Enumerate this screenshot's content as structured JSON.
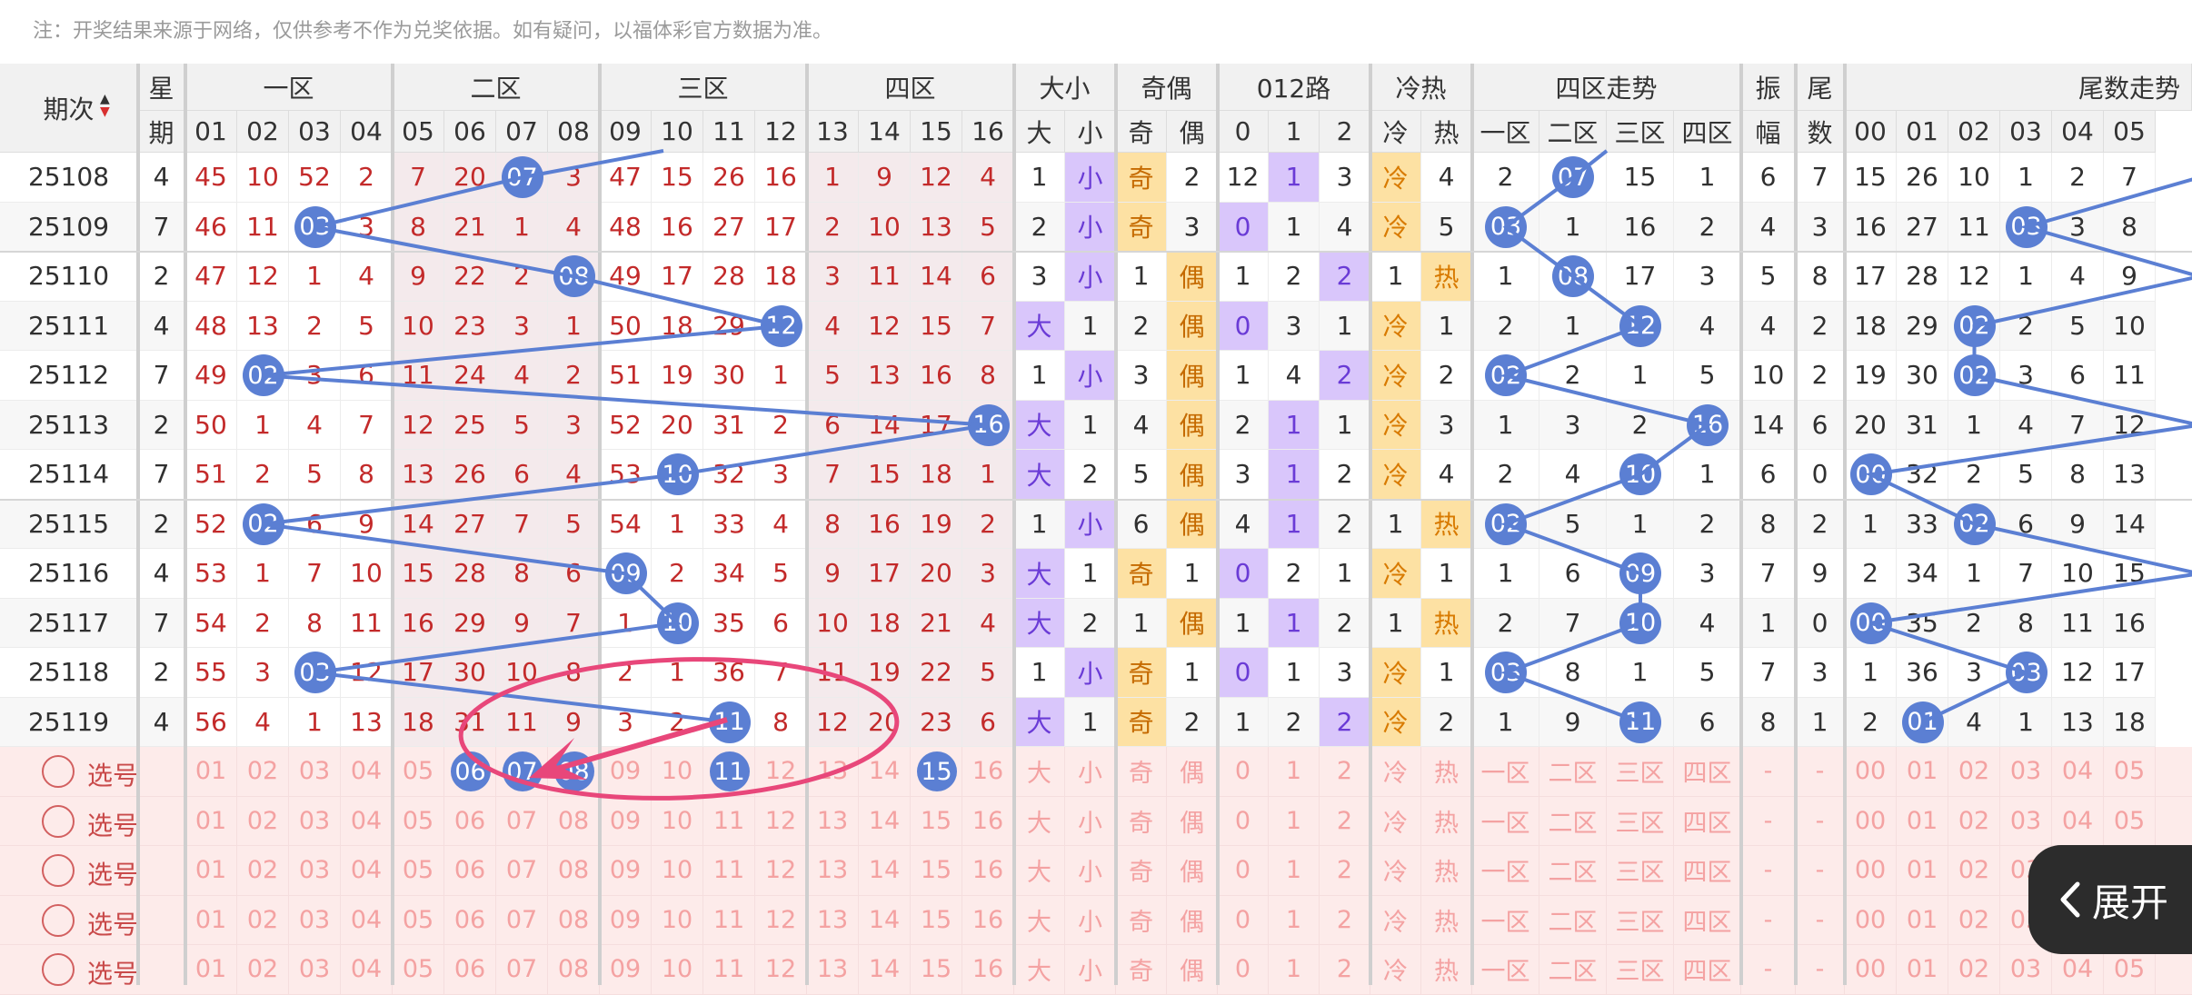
{
  "note": "注：开奖结果来源于网络，仅供参考不作为兑奖依据。如有疑问，以福体彩官方数据为准。",
  "colors": {
    "ball": "#5b7fd3",
    "red_text": "#c32a2a",
    "purple_hl": "#d9c6fb",
    "yellow_hl": "#fde1a3",
    "zone_shade": "#f4eaec",
    "pick_bg": "#fdebea",
    "pick_text": "#f4a2a2",
    "annotation": "#e8477a"
  },
  "headers": {
    "period": "期次",
    "weekday": [
      "星",
      "期"
    ],
    "groups": [
      "一区",
      "二区",
      "三区",
      "四区",
      "大小",
      "奇偶",
      "012路",
      "冷热",
      "四区走势",
      "振",
      "尾",
      "尾数走势"
    ],
    "amplitude_sub": "幅",
    "tail_sub": "数",
    "numbers": [
      "01",
      "02",
      "03",
      "04",
      "05",
      "06",
      "07",
      "08",
      "09",
      "10",
      "11",
      "12",
      "13",
      "14",
      "15",
      "16"
    ],
    "size": [
      "大",
      "小"
    ],
    "parity": [
      "奇",
      "偶"
    ],
    "road": [
      "0",
      "1",
      "2"
    ],
    "coldhot": [
      "冷",
      "热"
    ],
    "zones": [
      "一区",
      "二区",
      "三区",
      "四区"
    ],
    "tails": [
      "00",
      "01",
      "02",
      "03",
      "04",
      "05"
    ]
  },
  "rows": [
    {
      "period": "25108",
      "week": "4",
      "nums": [
        "45",
        "10",
        "52",
        "2",
        "7",
        "20",
        "07",
        "3",
        "47",
        "15",
        "26",
        "16",
        "1",
        "9",
        "12",
        "4"
      ],
      "size": [
        "1",
        "小"
      ],
      "parity": [
        "奇",
        "2"
      ],
      "road": [
        "12",
        "1",
        "3"
      ],
      "coldhot": [
        "冷",
        "4"
      ],
      "zones": [
        "2",
        "07",
        "15",
        "1"
      ],
      "amp": "6",
      "tail": "7",
      "tails": [
        "15",
        "26",
        "10",
        "1",
        "2",
        "7"
      ]
    },
    {
      "period": "25109",
      "week": "7",
      "nums": [
        "46",
        "11",
        "03",
        "3",
        "8",
        "21",
        "1",
        "4",
        "48",
        "16",
        "27",
        "17",
        "2",
        "10",
        "13",
        "5"
      ],
      "size": [
        "2",
        "小"
      ],
      "parity": [
        "奇",
        "3"
      ],
      "road": [
        "0",
        "1",
        "4"
      ],
      "coldhot": [
        "冷",
        "5"
      ],
      "zones": [
        "03",
        "1",
        "16",
        "2"
      ],
      "amp": "4",
      "tail": "3",
      "tails": [
        "16",
        "27",
        "11",
        "03",
        "3",
        "8"
      ]
    },
    {
      "period": "25110",
      "week": "2",
      "nums": [
        "47",
        "12",
        "1",
        "4",
        "9",
        "22",
        "2",
        "08",
        "49",
        "17",
        "28",
        "18",
        "3",
        "11",
        "14",
        "6"
      ],
      "size": [
        "3",
        "小"
      ],
      "parity": [
        "1",
        "偶"
      ],
      "road": [
        "1",
        "2",
        "2"
      ],
      "coldhot": [
        "1",
        "热"
      ],
      "zones": [
        "1",
        "08",
        "17",
        "3"
      ],
      "amp": "5",
      "tail": "8",
      "tails": [
        "17",
        "28",
        "12",
        "1",
        "4",
        "9"
      ]
    },
    {
      "period": "25111",
      "week": "4",
      "nums": [
        "48",
        "13",
        "2",
        "5",
        "10",
        "23",
        "3",
        "1",
        "50",
        "18",
        "29",
        "12",
        "4",
        "12",
        "15",
        "7"
      ],
      "size": [
        "大",
        "1"
      ],
      "parity": [
        "2",
        "偶"
      ],
      "road": [
        "0",
        "3",
        "1"
      ],
      "coldhot": [
        "冷",
        "1"
      ],
      "zones": [
        "2",
        "1",
        "12",
        "4"
      ],
      "amp": "4",
      "tail": "2",
      "tails": [
        "18",
        "29",
        "02",
        "2",
        "5",
        "10"
      ]
    },
    {
      "period": "25112",
      "week": "7",
      "nums": [
        "49",
        "02",
        "3",
        "6",
        "11",
        "24",
        "4",
        "2",
        "51",
        "19",
        "30",
        "1",
        "5",
        "13",
        "16",
        "8"
      ],
      "size": [
        "1",
        "小"
      ],
      "parity": [
        "3",
        "偶"
      ],
      "road": [
        "1",
        "4",
        "2"
      ],
      "coldhot": [
        "冷",
        "2"
      ],
      "zones": [
        "02",
        "2",
        "1",
        "5"
      ],
      "amp": "10",
      "tail": "2",
      "tails": [
        "19",
        "30",
        "02",
        "3",
        "6",
        "11"
      ]
    },
    {
      "period": "25113",
      "week": "2",
      "nums": [
        "50",
        "1",
        "4",
        "7",
        "12",
        "25",
        "5",
        "3",
        "52",
        "20",
        "31",
        "2",
        "6",
        "14",
        "17",
        "16"
      ],
      "size": [
        "大",
        "1"
      ],
      "parity": [
        "4",
        "偶"
      ],
      "road": [
        "2",
        "1",
        "1"
      ],
      "coldhot": [
        "冷",
        "3"
      ],
      "zones": [
        "1",
        "3",
        "2",
        "16"
      ],
      "amp": "14",
      "tail": "6",
      "tails": [
        "20",
        "31",
        "1",
        "4",
        "7",
        "12"
      ]
    },
    {
      "period": "25114",
      "week": "7",
      "nums": [
        "51",
        "2",
        "5",
        "8",
        "13",
        "26",
        "6",
        "4",
        "53",
        "10",
        "32",
        "3",
        "7",
        "15",
        "18",
        "1"
      ],
      "size": [
        "大",
        "2"
      ],
      "parity": [
        "5",
        "偶"
      ],
      "road": [
        "3",
        "1",
        "2"
      ],
      "coldhot": [
        "冷",
        "4"
      ],
      "zones": [
        "2",
        "4",
        "10",
        "1"
      ],
      "amp": "6",
      "tail": "0",
      "tails": [
        "00",
        "32",
        "2",
        "5",
        "8",
        "13"
      ]
    },
    {
      "period": "25115",
      "week": "2",
      "nums": [
        "52",
        "02",
        "6",
        "9",
        "14",
        "27",
        "7",
        "5",
        "54",
        "1",
        "33",
        "4",
        "8",
        "16",
        "19",
        "2"
      ],
      "size": [
        "1",
        "小"
      ],
      "parity": [
        "6",
        "偶"
      ],
      "road": [
        "4",
        "1",
        "2"
      ],
      "coldhot": [
        "1",
        "热"
      ],
      "zones": [
        "02",
        "5",
        "1",
        "2"
      ],
      "amp": "8",
      "tail": "2",
      "tails": [
        "1",
        "33",
        "02",
        "6",
        "9",
        "14"
      ]
    },
    {
      "period": "25116",
      "week": "4",
      "nums": [
        "53",
        "1",
        "7",
        "10",
        "15",
        "28",
        "8",
        "6",
        "09",
        "2",
        "34",
        "5",
        "9",
        "17",
        "20",
        "3"
      ],
      "size": [
        "大",
        "1"
      ],
      "parity": [
        "奇",
        "1"
      ],
      "road": [
        "0",
        "2",
        "1"
      ],
      "coldhot": [
        "冷",
        "1"
      ],
      "zones": [
        "1",
        "6",
        "09",
        "3"
      ],
      "amp": "7",
      "tail": "9",
      "tails": [
        "2",
        "34",
        "1",
        "7",
        "10",
        "15"
      ]
    },
    {
      "period": "25117",
      "week": "7",
      "nums": [
        "54",
        "2",
        "8",
        "11",
        "16",
        "29",
        "9",
        "7",
        "1",
        "10",
        "35",
        "6",
        "10",
        "18",
        "21",
        "4"
      ],
      "size": [
        "大",
        "2"
      ],
      "parity": [
        "1",
        "偶"
      ],
      "road": [
        "1",
        "1",
        "2"
      ],
      "coldhot": [
        "1",
        "热"
      ],
      "zones": [
        "2",
        "7",
        "10",
        "4"
      ],
      "amp": "1",
      "tail": "0",
      "tails": [
        "00",
        "35",
        "2",
        "8",
        "11",
        "16"
      ]
    },
    {
      "period": "25118",
      "week": "2",
      "nums": [
        "55",
        "3",
        "03",
        "12",
        "17",
        "30",
        "10",
        "8",
        "2",
        "1",
        "36",
        "7",
        "11",
        "19",
        "22",
        "5"
      ],
      "size": [
        "1",
        "小"
      ],
      "parity": [
        "奇",
        "1"
      ],
      "road": [
        "0",
        "1",
        "3"
      ],
      "coldhot": [
        "冷",
        "1"
      ],
      "zones": [
        "03",
        "8",
        "1",
        "5"
      ],
      "amp": "7",
      "tail": "3",
      "tails": [
        "1",
        "36",
        "3",
        "03",
        "12",
        "17"
      ]
    },
    {
      "period": "25119",
      "week": "4",
      "nums": [
        "56",
        "4",
        "1",
        "13",
        "18",
        "31",
        "11",
        "9",
        "3",
        "2",
        "11",
        "8",
        "12",
        "20",
        "23",
        "6"
      ],
      "size": [
        "大",
        "1"
      ],
      "parity": [
        "奇",
        "2"
      ],
      "road": [
        "1",
        "2",
        "2"
      ],
      "coldhot": [
        "冷",
        "2"
      ],
      "zones": [
        "1",
        "9",
        "11",
        "6"
      ],
      "amp": "8",
      "tail": "1",
      "tails": [
        "2",
        "01",
        "4",
        "1",
        "13",
        "18"
      ]
    }
  ],
  "pick": {
    "label": "选号",
    "size": [
      "大",
      "小"
    ],
    "parity": [
      "奇",
      "偶"
    ],
    "road": [
      "0",
      "1",
      "2"
    ],
    "coldhot": [
      "冷",
      "热"
    ],
    "zones": [
      "一区",
      "二区",
      "三区",
      "四区"
    ],
    "dash": "-",
    "tails": [
      "00",
      "01",
      "02",
      "03",
      "04",
      "05"
    ],
    "selected_first_row": [
      "06",
      "07",
      "08",
      "11",
      "15"
    ]
  },
  "expand_button": {
    "label": "展开",
    "icon": "chevron-left-icon"
  }
}
